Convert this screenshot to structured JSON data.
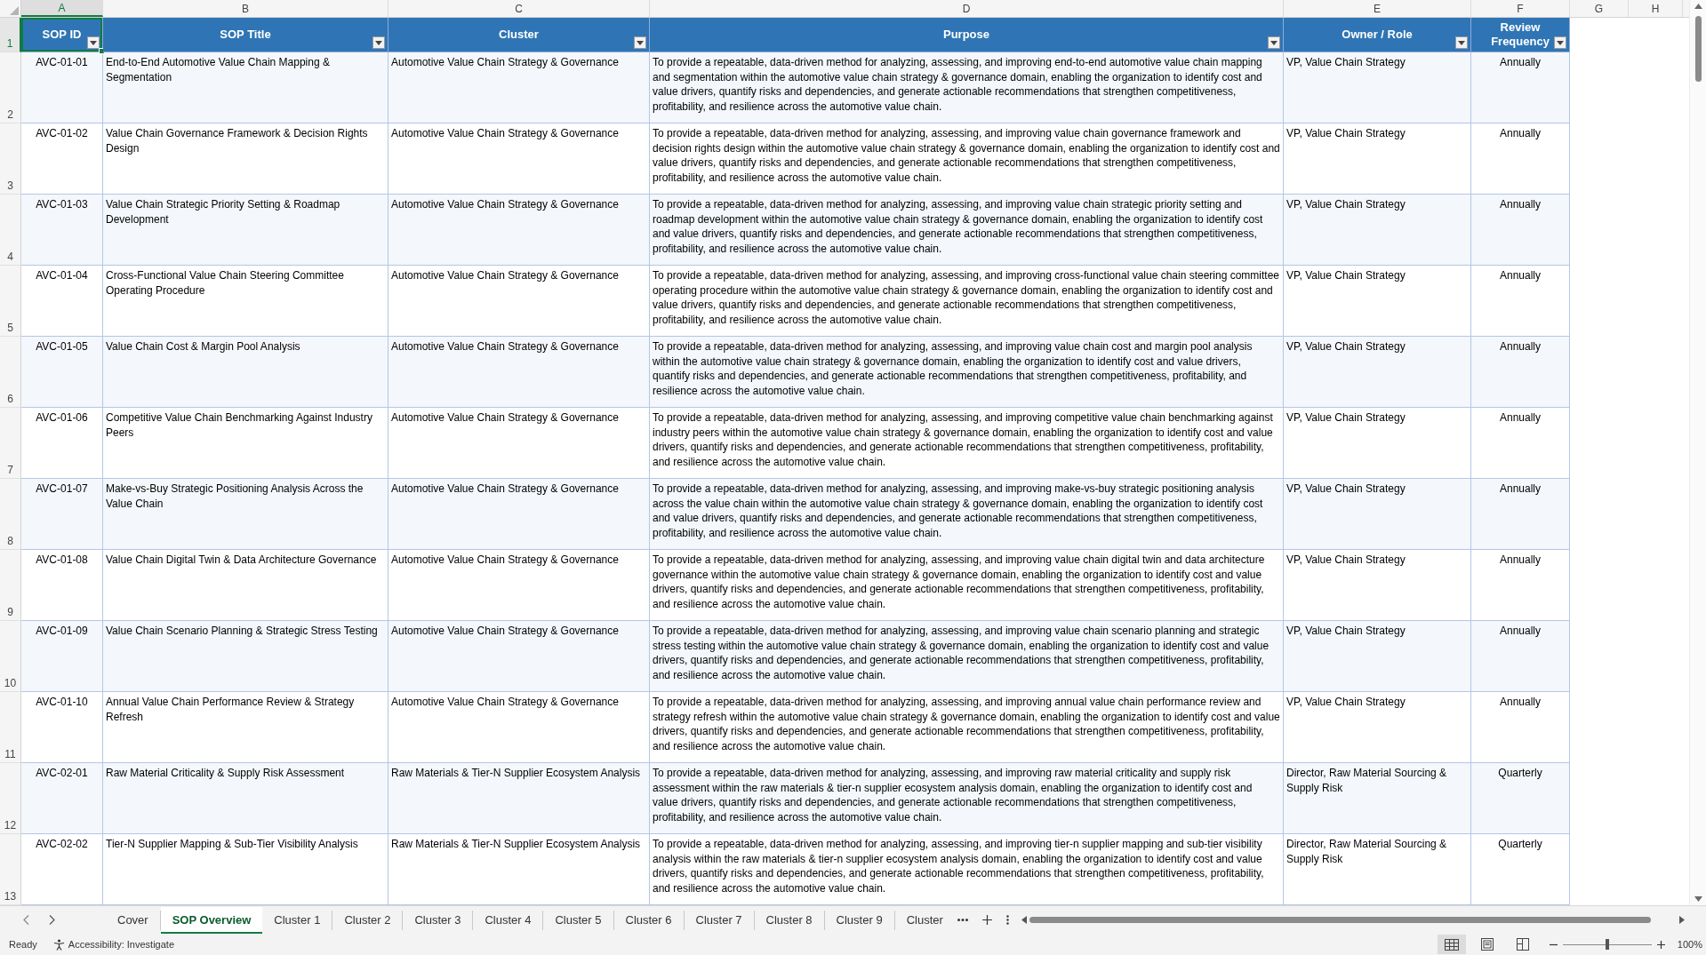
{
  "columns": [
    {
      "letter": "A",
      "selected": true
    },
    {
      "letter": "B",
      "selected": false
    },
    {
      "letter": "C",
      "selected": false
    },
    {
      "letter": "D",
      "selected": false
    },
    {
      "letter": "E",
      "selected": false
    },
    {
      "letter": "F",
      "selected": false
    },
    {
      "letter": "G",
      "selected": false
    },
    {
      "letter": "H",
      "selected": false
    }
  ],
  "header_row": {
    "number": "1",
    "selected": true,
    "cells": [
      {
        "text": "SOP ID",
        "selected": true,
        "filter": true
      },
      {
        "text": "SOP Title",
        "selected": false,
        "filter": true
      },
      {
        "text": "Cluster",
        "selected": false,
        "filter": true
      },
      {
        "text": "Purpose",
        "selected": false,
        "filter": true
      },
      {
        "text": "Owner / Role",
        "selected": false,
        "filter": true
      },
      {
        "text": "Review Frequency",
        "selected": false,
        "filter": true
      }
    ]
  },
  "rows": [
    {
      "number": "2",
      "selected": false,
      "cells": [
        "AVC-01-01",
        "End-to-End Automotive Value Chain Mapping & Segmentation",
        "Automotive Value Chain Strategy & Governance",
        "To provide a repeatable, data-driven method for analyzing, assessing, and improving end-to-end automotive value chain mapping and segmentation within the automotive value chain strategy & governance domain, enabling the organization to identify cost and value drivers, quantify risks and dependencies, and generate actionable recommendations that strengthen competitiveness, profitability, and resilience across the automotive value chain.",
        "VP, Value Chain Strategy",
        "Annually"
      ]
    },
    {
      "number": "3",
      "selected": false,
      "cells": [
        "AVC-01-02",
        "Value Chain Governance Framework & Decision Rights Design",
        "Automotive Value Chain Strategy & Governance",
        "To provide a repeatable, data-driven method for analyzing, assessing, and improving value chain governance framework and decision rights design within the automotive value chain strategy & governance domain, enabling the organization to identify cost and value drivers, quantify risks and dependencies, and generate actionable recommendations that strengthen competitiveness, profitability, and resilience across the automotive value chain.",
        "VP, Value Chain Strategy",
        "Annually"
      ]
    },
    {
      "number": "4",
      "selected": false,
      "cells": [
        "AVC-01-03",
        "Value Chain Strategic Priority Setting & Roadmap Development",
        "Automotive Value Chain Strategy & Governance",
        "To provide a repeatable, data-driven method for analyzing, assessing, and improving value chain strategic priority setting and roadmap development within the automotive value chain strategy & governance domain, enabling the organization to identify cost and value drivers, quantify risks and dependencies, and generate actionable recommendations that strengthen competitiveness, profitability, and resilience across the automotive value chain.",
        "VP, Value Chain Strategy",
        "Annually"
      ]
    },
    {
      "number": "5",
      "selected": false,
      "cells": [
        "AVC-01-04",
        "Cross-Functional Value Chain Steering Committee Operating Procedure",
        "Automotive Value Chain Strategy & Governance",
        "To provide a repeatable, data-driven method for analyzing, assessing, and improving cross-functional value chain steering committee operating procedure within the automotive value chain strategy & governance domain, enabling the organization to identify cost and value drivers, quantify risks and dependencies, and generate actionable recommendations that strengthen competitiveness, profitability, and resilience across the automotive value chain.",
        "VP, Value Chain Strategy",
        "Annually"
      ]
    },
    {
      "number": "6",
      "selected": false,
      "cells": [
        "AVC-01-05",
        "Value Chain Cost & Margin Pool Analysis",
        "Automotive Value Chain Strategy & Governance",
        "To provide a repeatable, data-driven method for analyzing, assessing, and improving value chain cost and margin pool analysis within the automotive value chain strategy & governance domain, enabling the organization to identify cost and value drivers, quantify risks and dependencies, and generate actionable recommendations that strengthen competitiveness, profitability, and resilience across the automotive value chain.",
        "VP, Value Chain Strategy",
        "Annually"
      ]
    },
    {
      "number": "7",
      "selected": false,
      "cells": [
        "AVC-01-06",
        "Competitive Value Chain Benchmarking Against Industry Peers",
        "Automotive Value Chain Strategy & Governance",
        "To provide a repeatable, data-driven method for analyzing, assessing, and improving competitive value chain benchmarking against industry peers within the automotive value chain strategy & governance domain, enabling the organization to identify cost and value drivers, quantify risks and dependencies, and generate actionable recommendations that strengthen competitiveness, profitability, and resilience across the automotive value chain.",
        "VP, Value Chain Strategy",
        "Annually"
      ]
    },
    {
      "number": "8",
      "selected": false,
      "cells": [
        "AVC-01-07",
        "Make-vs-Buy Strategic Positioning Analysis Across the Value Chain",
        "Automotive Value Chain Strategy & Governance",
        "To provide a repeatable, data-driven method for analyzing, assessing, and improving make-vs-buy strategic positioning analysis across the value chain within the automotive value chain strategy & governance domain, enabling the organization to identify cost and value drivers, quantify risks and dependencies, and generate actionable recommendations that strengthen competitiveness, profitability, and resilience across the automotive value chain.",
        "VP, Value Chain Strategy",
        "Annually"
      ]
    },
    {
      "number": "9",
      "selected": false,
      "cells": [
        "AVC-01-08",
        "Value Chain Digital Twin & Data Architecture Governance",
        "Automotive Value Chain Strategy & Governance",
        "To provide a repeatable, data-driven method for analyzing, assessing, and improving value chain digital twin and data architecture governance within the automotive value chain strategy & governance domain, enabling the organization to identify cost and value drivers, quantify risks and dependencies, and generate actionable recommendations that strengthen competitiveness, profitability, and resilience across the automotive value chain.",
        "VP, Value Chain Strategy",
        "Annually"
      ]
    },
    {
      "number": "10",
      "selected": false,
      "cells": [
        "AVC-01-09",
        "Value Chain Scenario Planning & Strategic Stress Testing",
        "Automotive Value Chain Strategy & Governance",
        "To provide a repeatable, data-driven method for analyzing, assessing, and improving value chain scenario planning and strategic stress testing within the automotive value chain strategy & governance domain, enabling the organization to identify cost and value drivers, quantify risks and dependencies, and generate actionable recommendations that strengthen competitiveness, profitability, and resilience across the automotive value chain.",
        "VP, Value Chain Strategy",
        "Annually"
      ]
    },
    {
      "number": "11",
      "selected": false,
      "cells": [
        "AVC-01-10",
        "Annual Value Chain Performance Review & Strategy Refresh",
        "Automotive Value Chain Strategy & Governance",
        "To provide a repeatable, data-driven method for analyzing, assessing, and improving annual value chain performance review and strategy refresh within the automotive value chain strategy & governance domain, enabling the organization to identify cost and value drivers, quantify risks and dependencies, and generate actionable recommendations that strengthen competitiveness, profitability, and resilience across the automotive value chain.",
        "VP, Value Chain Strategy",
        "Annually"
      ]
    },
    {
      "number": "12",
      "selected": false,
      "cells": [
        "AVC-02-01",
        "Raw Material Criticality & Supply Risk Assessment",
        "Raw Materials & Tier-N Supplier Ecosystem Analysis",
        "To provide a repeatable, data-driven method for analyzing, assessing, and improving raw material criticality and supply risk assessment within the raw materials & tier-n supplier ecosystem analysis domain, enabling the organization to identify cost and value drivers, quantify risks and dependencies, and generate actionable recommendations that strengthen competitiveness, profitability, and resilience across the automotive value chain.",
        "Director, Raw Material Sourcing & Supply Risk",
        "Quarterly"
      ]
    },
    {
      "number": "13",
      "selected": false,
      "cells": [
        "AVC-02-02",
        "Tier-N Supplier Mapping & Sub-Tier Visibility Analysis",
        "Raw Materials & Tier-N Supplier Ecosystem Analysis",
        "To provide a repeatable, data-driven method for analyzing, assessing, and improving tier-n supplier mapping and sub-tier visibility analysis within the raw materials & tier-n supplier ecosystem analysis domain, enabling the organization to identify cost and value drivers, quantify risks and dependencies, and generate actionable recommendations that strengthen competitiveness, profitability, and resilience across the automotive value chain.",
        "Director, Raw Material Sourcing & Supply Risk",
        "Quarterly"
      ]
    }
  ],
  "sheet_tabs": [
    {
      "label": "Cover",
      "selected": false
    },
    {
      "label": "SOP Overview",
      "selected": true
    },
    {
      "label": "Cluster 1",
      "selected": false
    },
    {
      "label": "Cluster 2",
      "selected": false
    },
    {
      "label": "Cluster 3",
      "selected": false
    },
    {
      "label": "Cluster 4",
      "selected": false
    },
    {
      "label": "Cluster 5",
      "selected": false
    },
    {
      "label": "Cluster 6",
      "selected": false
    },
    {
      "label": "Cluster 7",
      "selected": false
    },
    {
      "label": "Cluster 8",
      "selected": false
    },
    {
      "label": "Cluster 9",
      "selected": false
    },
    {
      "label": "Cluster",
      "selected": false
    }
  ],
  "status_bar": {
    "status": "Ready",
    "accessibility": "Accessibility: Investigate",
    "views": [
      {
        "kind": "normal",
        "selected": true
      },
      {
        "kind": "page_layout",
        "selected": false
      },
      {
        "kind": "page_break",
        "selected": false
      }
    ],
    "zoom_slider": {
      "level": 0.5
    },
    "zoom": "100%"
  }
}
